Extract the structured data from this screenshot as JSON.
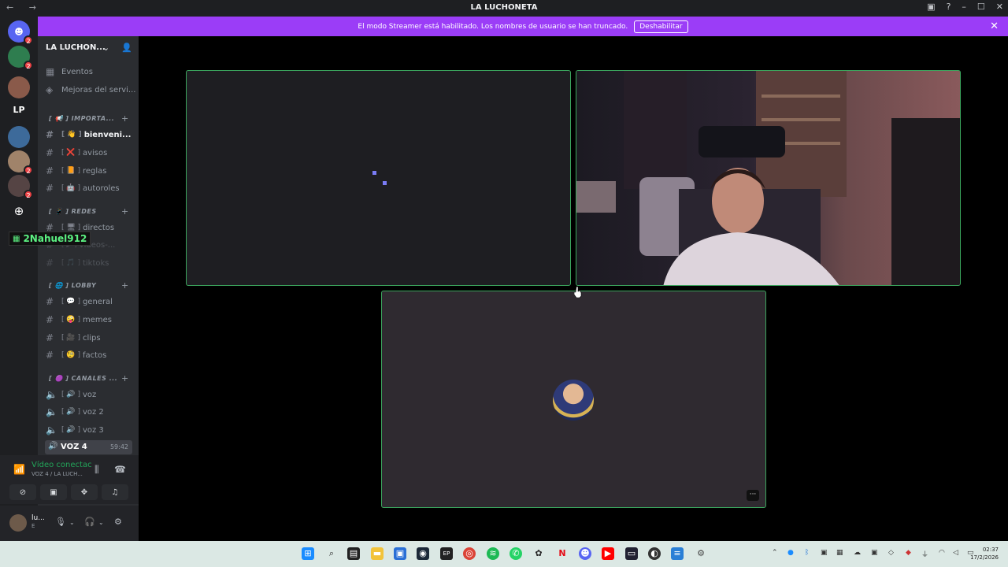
{
  "titlebar": {
    "title": "LA LUCHONETA",
    "nav": "← →"
  },
  "streamer_banner": {
    "text": "El modo Streamer está habilitado. Los nombres de usuario se han truncado.",
    "button": "Deshabilitar"
  },
  "guilds": {
    "lp_label": "LP",
    "badges": [
      "2",
      "2",
      "2",
      "2"
    ]
  },
  "server": {
    "name": "LA LUCHON..."
  },
  "top_items": [
    {
      "label": "Eventos"
    },
    {
      "label": "Mejoras del servi..."
    }
  ],
  "categories": [
    {
      "label": "[ 📢 ] IMPORTA...",
      "channels": [
        {
          "emoji": "[ 👋 ]",
          "label": "bienveni...",
          "active": true
        },
        {
          "emoji": "[ ❌ ]",
          "label": "avisos"
        },
        {
          "emoji": "[ 📙 ]",
          "label": "reglas"
        },
        {
          "emoji": "[ 🤖 ]",
          "label": "autoroles"
        }
      ]
    },
    {
      "label": "[ 📱 ] REDES",
      "channels": [
        {
          "emoji": "[ 🖥 ]",
          "label": "directos"
        },
        {
          "emoji": "[ ▶ ]",
          "label": "videos-..."
        },
        {
          "emoji": "[ 🎵 ]",
          "label": "tiktoks"
        }
      ]
    },
    {
      "label": "[ 🌐 ] LOBBY",
      "channels": [
        {
          "emoji": "[ 💬 ]",
          "label": "general"
        },
        {
          "emoji": "[ 🤪 ]",
          "label": "memes"
        },
        {
          "emoji": "[ 🎥 ]",
          "label": "clips"
        },
        {
          "emoji": "[ 🧐 ]",
          "label": "factos"
        }
      ]
    },
    {
      "label": "[ 🟣 ] CANALES ...",
      "channels": [
        {
          "emoji": "[ 🔊 ]",
          "label": "voz"
        },
        {
          "emoji": "[ 🔊 ]",
          "label": "voz 2"
        },
        {
          "emoji": "[ 🔊 ]",
          "label": "voz 3"
        }
      ]
    }
  ],
  "nick_tag": "2Nahuel912",
  "active_voice": {
    "label": "VOZ 4",
    "time": "59:42"
  },
  "voice_panel": {
    "status": "Vídeo conectac",
    "sub": "VOZ 4 / LA LUCH..."
  },
  "user_panel": {
    "name": "lu...",
    "status": "E"
  },
  "clock": {
    "time": "02:37",
    "date": "17/2/2026"
  },
  "colors": {
    "speaking_border": "#3ba55d",
    "streamer_banner": "#9b3df7",
    "online": "#23a55a"
  }
}
